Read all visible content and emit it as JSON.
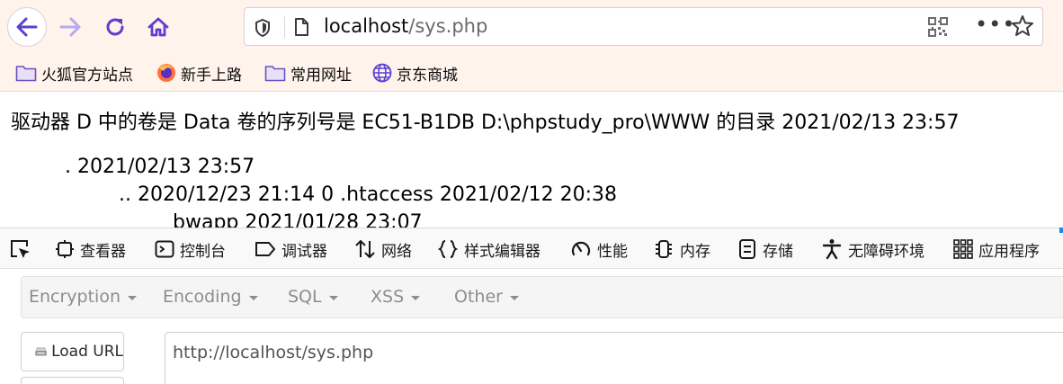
{
  "toolbar": {
    "back_icon": "arrow-left-icon",
    "forward_icon": "arrow-right-icon",
    "reload_icon": "reload-icon",
    "home_icon": "home-icon",
    "url_host": "localhost",
    "url_path": "/sys.php",
    "accent_color": "#5b3fd1"
  },
  "bookmarks": [
    {
      "label": "火狐官方站点",
      "icon": "folder-icon"
    },
    {
      "label": "新手上路",
      "icon": "firefox-icon"
    },
    {
      "label": "常用网址",
      "icon": "folder-icon"
    },
    {
      "label": "京东商城",
      "icon": "globe-icon"
    }
  ],
  "page": {
    "line1": "驱动器 D 中的卷是 Data 卷的序列号是 EC51-B1DB D:\\phpstudy_pro\\WWW 的目录 2021/02/13 23:57",
    "line2": ". 2021/02/13 23:57",
    "line3": ".. 2020/12/23 21:14 0 .htaccess 2021/02/12 20:38",
    "line4": "bwapp 2021/01/28 23:07"
  },
  "devtools": {
    "tabs": [
      {
        "label": "查看器",
        "icon": "inspector-icon"
      },
      {
        "label": "控制台",
        "icon": "console-icon"
      },
      {
        "label": "调试器",
        "icon": "debugger-icon"
      },
      {
        "label": "网络",
        "icon": "network-icon"
      },
      {
        "label": "样式编辑器",
        "icon": "braces-icon"
      },
      {
        "label": "性能",
        "icon": "gauge-icon"
      },
      {
        "label": "内存",
        "icon": "memory-icon"
      },
      {
        "label": "存储",
        "icon": "storage-icon"
      },
      {
        "label": "无障碍环境",
        "icon": "accessibility-icon"
      },
      {
        "label": "应用程序",
        "icon": "grid-icon"
      }
    ]
  },
  "hackbar": {
    "menu": [
      "Encryption",
      "Encoding",
      "SQL",
      "XSS",
      "Other"
    ],
    "load_url_label": "Load URL",
    "url_value": "http://localhost/sys.php"
  }
}
